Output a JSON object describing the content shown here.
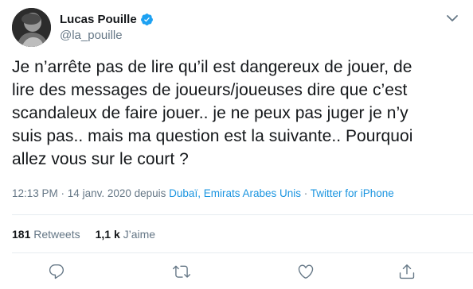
{
  "user": {
    "name": "Lucas Pouille",
    "handle": "@la_pouille",
    "verified": true
  },
  "tweet": {
    "text": "Je n’arrête pas de lire qu’il est dangereux de jouer, de\nlire des messages de joueurs/joueuses dire que c’est\nscandaleux de faire jouer.. je ne peux pas juger je n’y\nsuis pas.. mais ma question est la suivante.. Pourquoi\nallez vous sur le court ?",
    "time": "12:13 PM",
    "sep1": " · ",
    "date": "14 janv. 2020",
    "from_label": " depuis ",
    "location": "Dubaï, Emirats Arabes Unis",
    "sep2": " · ",
    "source": "Twitter for iPhone"
  },
  "stats": {
    "retweets_count": "181",
    "retweets_label": "Retweets",
    "likes_count": "1,1 k",
    "likes_label": "J’aime"
  },
  "icons": {
    "menu": "chevron-down-icon",
    "reply": "reply-icon",
    "retweet": "retweet-icon",
    "like": "heart-icon",
    "share": "share-icon",
    "verified": "verified-badge-icon"
  },
  "colors": {
    "link": "#1b95e0",
    "muted": "#657786",
    "text": "#14171a",
    "divider": "#e6ecf0",
    "verified": "#1da1f2"
  }
}
